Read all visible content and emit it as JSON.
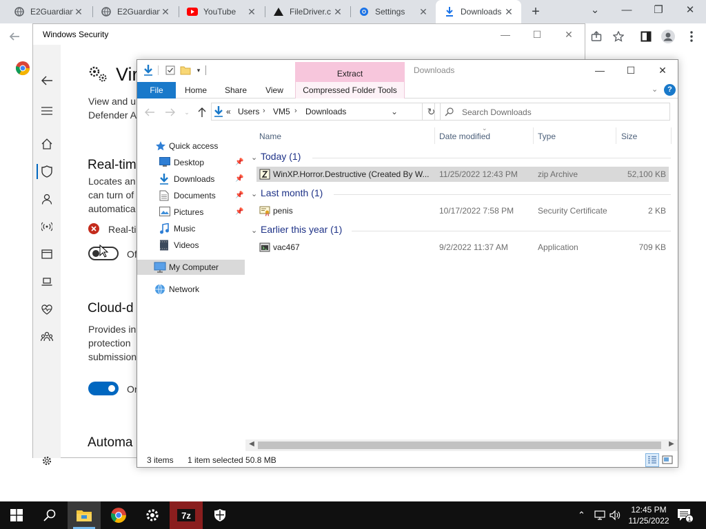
{
  "browser": {
    "tabs": [
      {
        "label": "E2Guardian",
        "icon": "e2guardian-icon"
      },
      {
        "label": "E2Guardian",
        "icon": "e2guardian-icon"
      },
      {
        "label": "YouTube",
        "icon": "youtube-icon"
      },
      {
        "label": "FileDriver.c",
        "icon": "filedriver-icon"
      },
      {
        "label": "Settings",
        "icon": "gear-icon"
      },
      {
        "label": "Downloads",
        "icon": "download-icon"
      }
    ],
    "new_tab": "+"
  },
  "windows_security": {
    "title": "Windows Security",
    "heading": "Vir",
    "intro_line1": "View and u",
    "intro_line2": "Defender A",
    "realtime_title": "Real-tim",
    "realtime_line1": "Locates an",
    "realtime_line2": "can turn of",
    "realtime_line3": "automatica",
    "realtime_warning": "Real-ti",
    "realtime_toggle_label": "Of",
    "cloud_title": "Cloud-d",
    "cloud_line1": "Provides in",
    "cloud_line2": "protection",
    "cloud_line3": "submission",
    "cloud_toggle_label": "Or",
    "auto_title": "Automa"
  },
  "explorer": {
    "title": "Downloads",
    "context_tab_group": "Extract",
    "ribbon_tabs": [
      "File",
      "Home",
      "Share",
      "View",
      "Compressed Folder Tools"
    ],
    "breadcrumb": {
      "overflow": "«",
      "parts": [
        "Users",
        "VM5",
        "Downloads"
      ]
    },
    "search_placeholder": "Search Downloads",
    "nav": {
      "quick_access": "Quick access",
      "items": [
        {
          "label": "Desktop",
          "icon": "desktop-icon",
          "pinned": true
        },
        {
          "label": "Downloads",
          "icon": "download-icon",
          "pinned": true
        },
        {
          "label": "Documents",
          "icon": "documents-icon",
          "pinned": true
        },
        {
          "label": "Pictures",
          "icon": "pictures-icon",
          "pinned": true
        },
        {
          "label": "Music",
          "icon": "music-icon",
          "pinned": false
        },
        {
          "label": "Videos",
          "icon": "videos-icon",
          "pinned": false
        }
      ],
      "my_computer": "My Computer",
      "network": "Network"
    },
    "columns": {
      "name": "Name",
      "date": "Date modified",
      "type": "Type",
      "size": "Size"
    },
    "groups": [
      {
        "label": "Today (1)",
        "files": [
          {
            "name": "WinXP.Horror.Destructive  (Created By W...",
            "date": "11/25/2022 12:43 PM",
            "type": "zip Archive",
            "size": "52,100 KB",
            "icon": "zip-archive-icon",
            "selected": true
          }
        ]
      },
      {
        "label": "Last month (1)",
        "files": [
          {
            "name": "penis",
            "date": "10/17/2022 7:58 PM",
            "type": "Security Certificate",
            "size": "2 KB",
            "icon": "certificate-icon",
            "selected": false
          }
        ]
      },
      {
        "label": "Earlier this year (1)",
        "files": [
          {
            "name": "vac467",
            "date": "9/2/2022 11:37 AM",
            "type": "Application",
            "size": "709 KB",
            "icon": "application-icon",
            "selected": false
          }
        ]
      }
    ],
    "status": {
      "items": "3 items",
      "selected": "1 item selected  50.8 MB"
    }
  },
  "taskbar": {
    "apps": [
      "start-icon",
      "search-icon",
      "file-explorer-icon",
      "chrome-icon",
      "settings-icon",
      "7zip-icon",
      "windows-security-icon"
    ],
    "time": "12:45 PM",
    "date": "11/25/2022",
    "notifications": "1"
  },
  "colors": {
    "accent": "#0067c0",
    "ribbon_file": "#1979ca",
    "context_tab": "#f7c6dc",
    "taskbar": "#101010"
  }
}
